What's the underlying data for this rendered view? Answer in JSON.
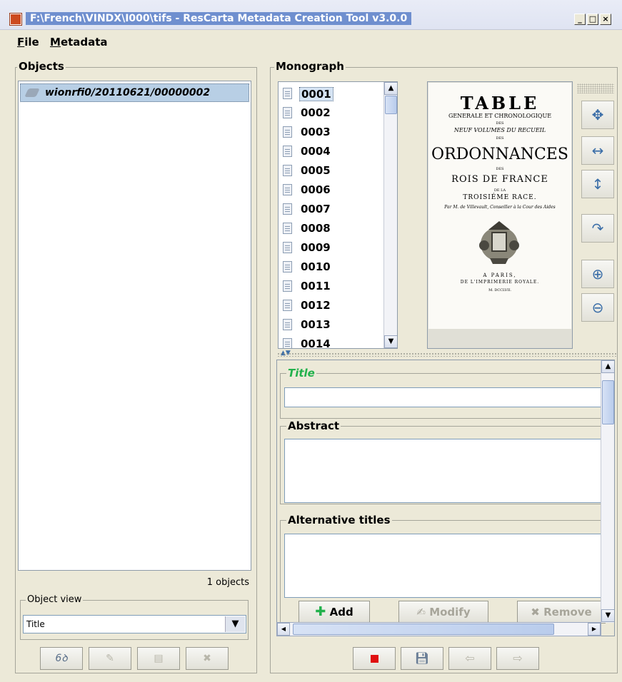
{
  "window": {
    "title": "F:\\French\\VINDX\\I000\\tifs - ResCarta Metadata Creation Tool v3.0.0",
    "minimize": "_",
    "maximize": "□",
    "close": "×"
  },
  "menu": {
    "file": {
      "mnemonic": "F",
      "rest": "ile"
    },
    "metadata": {
      "mnemonic": "M",
      "rest": "etadata"
    }
  },
  "objects_panel": {
    "legend": "Objects",
    "items": [
      {
        "label": "wionrfi0/20110621/00000002"
      }
    ],
    "count_text": "1 objects",
    "object_view": {
      "legend": "Object view",
      "selected": "Title"
    },
    "toolbar_icons": [
      "glasses-icon",
      "pencil-icon",
      "edit-form-icon",
      "delete-icon"
    ]
  },
  "monograph_panel": {
    "legend": "Monograph",
    "files": [
      "0001",
      "0002",
      "0003",
      "0004",
      "0005",
      "0006",
      "0007",
      "0008",
      "0009",
      "0010",
      "0011",
      "0012",
      "0013",
      "0014"
    ],
    "selected_file": "0001",
    "preview": {
      "line1": "TABLE",
      "line2": "GENERALE ET CHRONOLOGIQUE",
      "line3": "DES",
      "line4": "NEUF VOLUMES DU RECUEIL",
      "line5": "DES",
      "line6": "ORDONNANCES",
      "line7": "DES",
      "line8": "ROIS DE FRANCE",
      "line9": "DE LA",
      "line10": "TROISIÉME RACE.",
      "line11": "Par M. de Villevault, Conseiller à la Cour des Aides",
      "line12": "A PARIS,",
      "line13": "DE L'IMPRIMERIE ROYALE.",
      "line14": "M. DCCLVII."
    },
    "view_tools": [
      "move-icon",
      "fit-width-icon",
      "fit-height-icon",
      "rotate-icon",
      "zoom-in-icon",
      "zoom-out-icon"
    ]
  },
  "metadata_form": {
    "title_label": "Title",
    "title_value": "",
    "abstract_label": "Abstract",
    "abstract_value": "",
    "alt_titles_label": "Alternative titles",
    "add_label": "Add",
    "modify_label": "Modify",
    "remove_label": "Remove"
  },
  "colors": {
    "required_label": "#22b14c",
    "selection": "#b8cfe5",
    "stop_red": "#e01010"
  }
}
